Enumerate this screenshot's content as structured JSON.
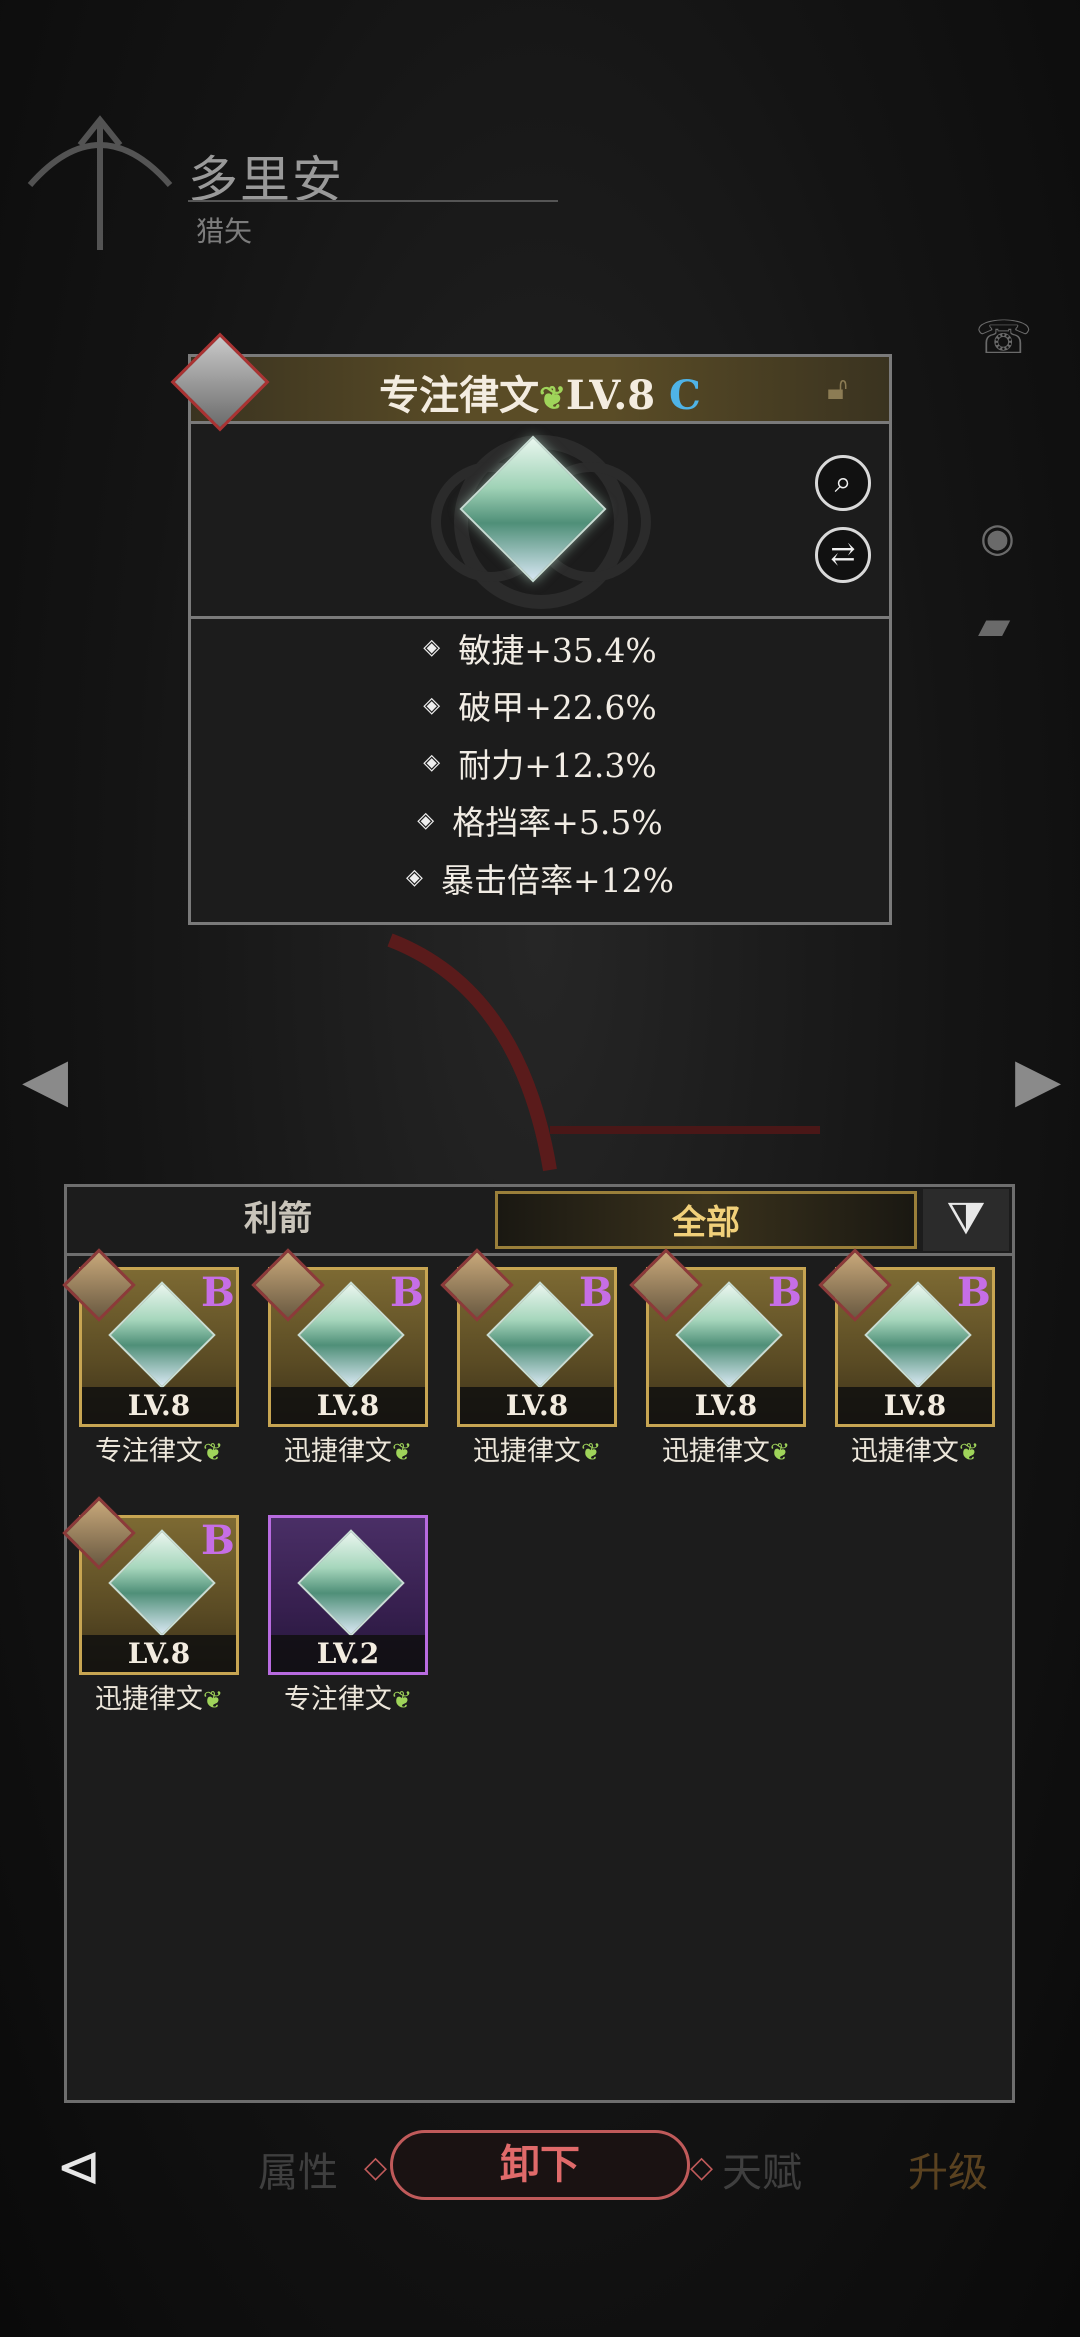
{
  "hero": {
    "name": "多里安",
    "class": "猎矢"
  },
  "detail": {
    "name": "专注律文",
    "level": "LV.8",
    "grade": "C",
    "stats": [
      "敏捷+35.4%",
      "破甲+22.6%",
      "耐力+12.3%",
      "格挡率+5.5%",
      "暴击倍率+12%"
    ]
  },
  "tabs": {
    "arrows": "利箭",
    "all": "全部"
  },
  "items": [
    {
      "level": "LV.8",
      "name": "专注律文",
      "grade": "B",
      "frame": "gold"
    },
    {
      "level": "LV.8",
      "name": "迅捷律文",
      "grade": "B",
      "frame": "gold"
    },
    {
      "level": "LV.8",
      "name": "迅捷律文",
      "grade": "B",
      "frame": "gold"
    },
    {
      "level": "LV.8",
      "name": "迅捷律文",
      "grade": "B",
      "frame": "gold"
    },
    {
      "level": "LV.8",
      "name": "迅捷律文",
      "grade": "B",
      "frame": "gold"
    },
    {
      "level": "LV.8",
      "name": "迅捷律文",
      "grade": "B",
      "frame": "gold"
    },
    {
      "level": "LV.2",
      "name": "专注律文",
      "grade": "",
      "frame": "purple"
    }
  ],
  "bottom": {
    "attributes": "属性",
    "unload": "卸下",
    "talent": "天赋",
    "upgrade": "升级"
  },
  "icons": {
    "rune_mark": "rune-leaf-icon",
    "search": "search-icon",
    "swap": "swap-icon",
    "lock": "lock-icon",
    "filter": "filter-icon",
    "back": "back-icon"
  }
}
